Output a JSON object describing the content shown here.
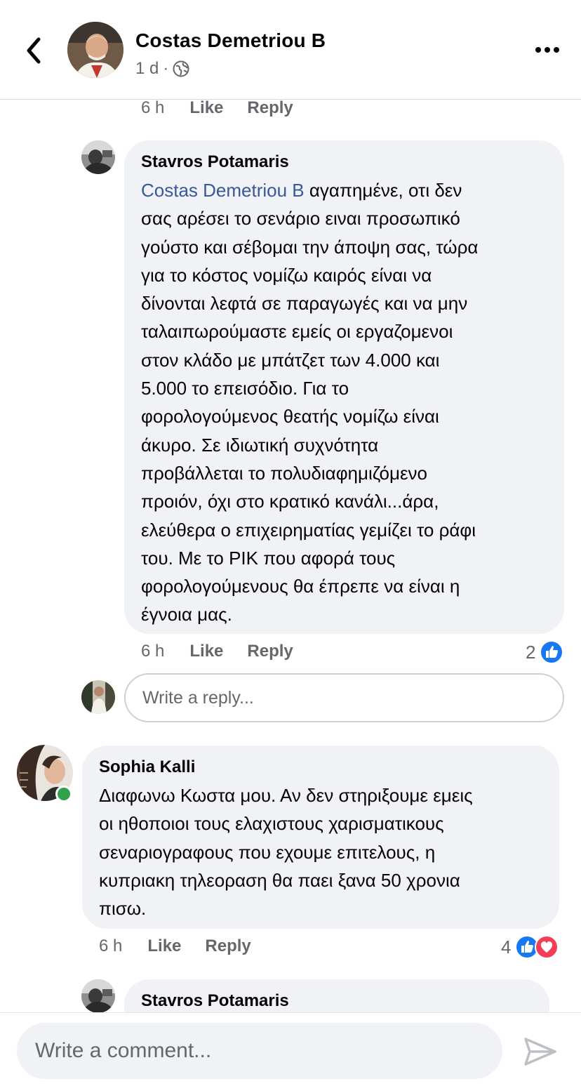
{
  "header": {
    "back_icon": "chevron-left-icon",
    "author_name": "Costas Demetriou B",
    "time": "1 d",
    "separator": "·",
    "privacy_icon": "globe-icon",
    "more_icon": "more-horizontal-icon"
  },
  "top_actions": {
    "time": "6 h",
    "like": "Like",
    "reply": "Reply"
  },
  "reply_comment": {
    "author": "Stavros Potamaris",
    "mention": "Costas Demetriou B",
    "text": " αγαπημένε, οτι δεν\nσας αρέσει το σενάριο ειναι προσωπικό\nγούστο και σέβομαι την άποψη σας, τώρα\nγια το κόστος νομίζω καιρός είναι να\nδίνονται λεφτά σε παραγωγές και να μην\nταλαιπωρούμαστε εμείς οι εργαζομενοι\nστον κλάδο με μπάτζετ των 4.000 και\n5.000 το επεισόδιο. Για το\nφορολογούμενος θεατής νομίζω είναι\nάκυρο. Σε ιδιωτική συχνότητα\nπροβάλλεται το πολυδιαφημιζόμενο\nπροιόν, όχι στο κρατικό κανάλι...άρα,\nελεύθερα ο επιχειρηματίας γεμίζει το ράφι\nτου. Με το ΡΙΚ που αφορά τους\nφορολογούμενους θα έπρεπε να είναι η\nέγνοια μας.",
    "time": "6 h",
    "like": "Like",
    "reply": "Reply",
    "reaction_count": "2",
    "reaction_icons": [
      "like-reaction-icon"
    ]
  },
  "reply_box": {
    "placeholder": "Write a reply..."
  },
  "comment_sophia": {
    "author": "Sophia Kalli",
    "text": "Διαφωνω Κωστα μου. Αν δεν στηριξουμε εμεις\nοι ηθοποιοι τους ελαχιστους χαρισματικους\nσεναριογραφους που εχουμε επιτελους,  η\nκυπριακη τηλεοραση θα παει ξανα 50 χρονια\nπισω.",
    "time": "6 h",
    "like": "Like",
    "reply": "Reply",
    "reaction_count": "4",
    "reaction_icons": [
      "like-reaction-icon",
      "love-reaction-icon"
    ],
    "online": true
  },
  "next_comment": {
    "author": "Stavros Potamaris"
  },
  "composer": {
    "placeholder": "Write a comment...",
    "send_icon": "send-icon"
  },
  "colors": {
    "link": "#385898",
    "secondary_text": "#65676b",
    "bubble_bg": "#f0f2f5",
    "like_blue": "#1877f2",
    "love_red": "#f33e58",
    "online_green": "#31a24c"
  }
}
